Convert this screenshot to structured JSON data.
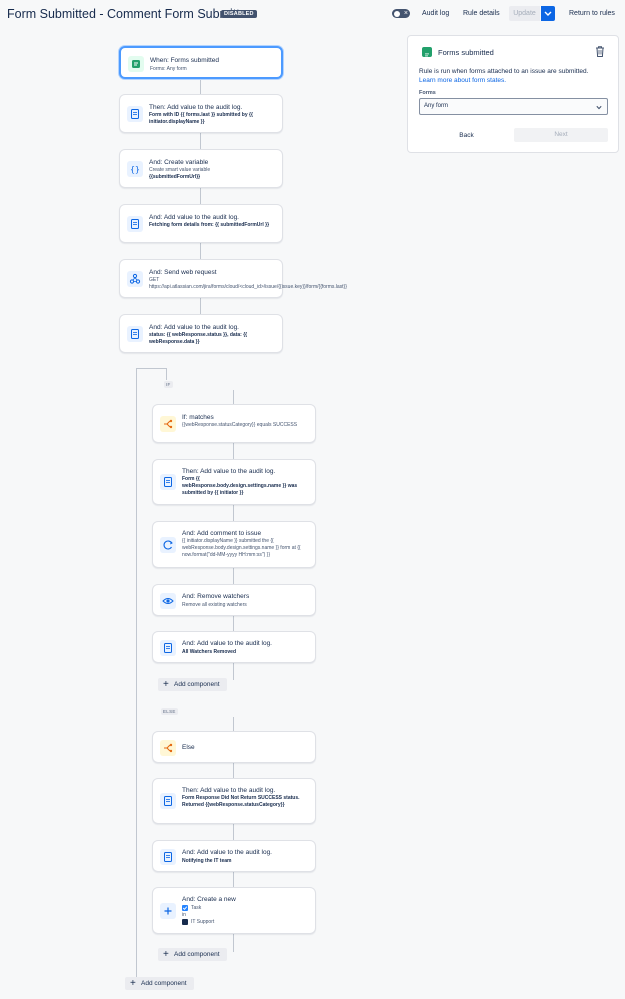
{
  "header": {
    "title": "Form Submitted - Comment Form Submitter",
    "status_badge": "DISABLED",
    "audit_log": "Audit log",
    "rule_details": "Rule details",
    "update": "Update",
    "return": "Return to rules"
  },
  "components": [
    {
      "title": "When: Forms submitted",
      "sub": "Forms: Any form",
      "icon": "forms-icon"
    },
    {
      "title": "Then: Add value to the audit log.",
      "sub": "Form with ID {{ forms.last }} submitted by {{ initiator.displayName }}",
      "icon": "audit-log-icon"
    },
    {
      "title": "And: Create variable",
      "sub": "Create smart value variable",
      "sub2": "{{submittedFormUrl}}",
      "icon": "variable-icon"
    },
    {
      "title": "And: Add value to the audit log.",
      "sub": "Fetching form details from: {{ submittedFormUrl }}",
      "icon": "audit-log-icon"
    },
    {
      "title": "And: Send web request",
      "sub": "GET https://api.atlassian.com/jira/forms/cloud/<cloud_id>/issue/{{issue.key}}/form/{{forms.last}}",
      "icon": "webhook-icon"
    },
    {
      "title": "And: Add value to the audit log.",
      "sub": "status: {{ webResponse.status }}, data: {{ webResponse.data }}",
      "icon": "audit-log-icon"
    }
  ],
  "if_branch": {
    "tag": "IF",
    "items": [
      {
        "title": "If: matches",
        "sub": "{{webResponse.statusCategory}} equals SUCCESS",
        "icon": "branch-icon"
      },
      {
        "title": "Then: Add value to the audit log.",
        "sub": "Form {{ webResponse.body.design.settings.name }} was submitted by {{ initiator }}",
        "icon": "audit-log-icon"
      },
      {
        "title": "And: Add comment to issue",
        "sub": "{{ initiator.displayName }} submitted the {{ webResponse.body.design.settings.name }} form at {{ now.format(\"dd-MM-yyyy HH:mm:ss\") }}",
        "icon": "comment-icon"
      },
      {
        "title": "And: Remove watchers",
        "sub": "Remove all existing watchers",
        "icon": "eye-icon"
      },
      {
        "title": "And: Add value to the audit log.",
        "sub": "All Watchers Removed",
        "icon": "audit-log-icon"
      }
    ],
    "add_component": "Add component"
  },
  "else_branch": {
    "tag": "ELSE",
    "items": [
      {
        "title": "Else",
        "icon": "branch-icon"
      },
      {
        "title": "Then: Add value to the audit log.",
        "sub": "Form Response Did Not Return SUCCESS status. Returned {{webResponse.statusCategory}}",
        "icon": "audit-log-icon"
      },
      {
        "title": "And: Add value to the audit log.",
        "sub": "Notifying the IT team",
        "icon": "audit-log-icon"
      },
      {
        "title": "And: Create a new",
        "issue_type": "Task",
        "in_label": "in",
        "project": "IT Support",
        "icon": "plus-icon"
      }
    ],
    "add_component": "Add component"
  },
  "bottom_add_component": "Add component",
  "panel": {
    "title": "Forms submitted",
    "description": "Rule is run when forms attached to an issue are submitted.",
    "link": "Learn more about form states.",
    "forms_label": "Forms",
    "forms_value": "Any form",
    "back": "Back",
    "next": "Next"
  },
  "colors": {
    "primary": "#0c66e4",
    "selected_border": "#4c9aff",
    "forms_green": "#22a06b",
    "badge_bg": "#42526e"
  }
}
